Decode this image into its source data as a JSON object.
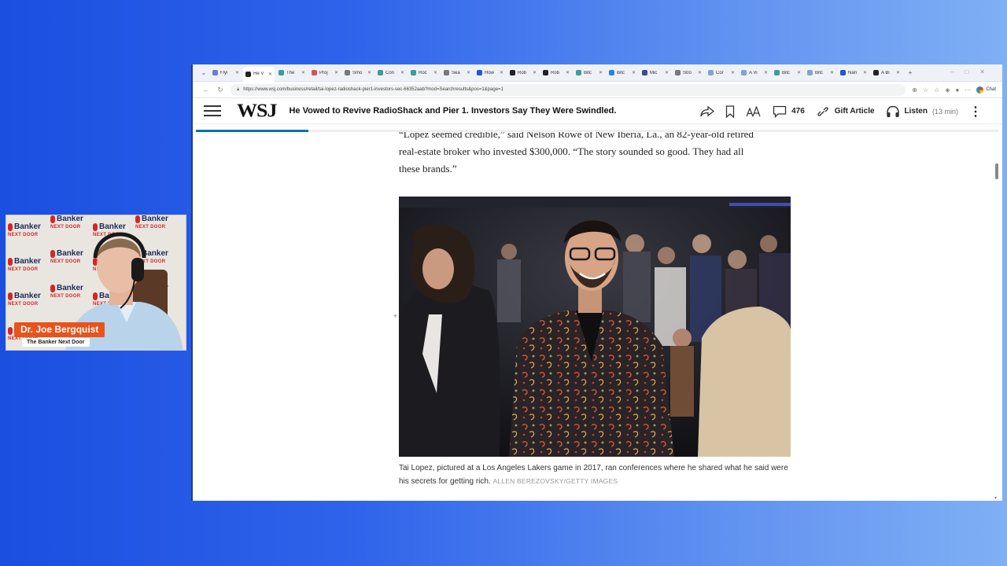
{
  "webcam": {
    "name": "Dr. Joe Bergquist",
    "title": "The Banker Next Door",
    "backdrop_logo": "Banker",
    "backdrop_sub": "NEXT DOOR",
    "accent": "#e8521b"
  },
  "browser": {
    "tabs": [
      {
        "label": "Flyi",
        "color": "#6b7bd6"
      },
      {
        "label": "He V",
        "color": "#222222",
        "active": true
      },
      {
        "label": "The",
        "color": "#3c9b9b"
      },
      {
        "label": "Proj",
        "color": "#d9534f"
      },
      {
        "label": "Smo",
        "color": "#777777"
      },
      {
        "label": "Con",
        "color": "#3c9b9b"
      },
      {
        "label": "Roc",
        "color": "#3c9b9b"
      },
      {
        "label": "Sea",
        "color": "#777777"
      },
      {
        "label": "How",
        "color": "#1f57d6"
      },
      {
        "label": "Rob",
        "color": "#222222"
      },
      {
        "label": "Rob",
        "color": "#222222"
      },
      {
        "label": "Bitc",
        "color": "#3c9b9b"
      },
      {
        "label": "Bitc",
        "color": "#1e88e5"
      },
      {
        "label": "Mic",
        "color": "#3c4b8a"
      },
      {
        "label": "Stro",
        "color": "#777777"
      },
      {
        "label": "Cor",
        "color": "#8aa0c8"
      },
      {
        "label": "A Vi",
        "color": "#8aa0c8"
      },
      {
        "label": "Bitc",
        "color": "#3c9b9b"
      },
      {
        "label": "Bitc",
        "color": "#8aa0c8"
      },
      {
        "label": "Nan",
        "color": "#1f57d6"
      },
      {
        "label": "A Bi",
        "color": "#222222"
      }
    ],
    "new_tab_label": "+",
    "url": "https://www.wsj.com/business/retail/tai-lopez-radioshack-pier1-investors-sec-66352aab?mod=Searchresults&pos=1&page=1",
    "chat_label": "Chat"
  },
  "wsj": {
    "logo": "WSJ",
    "headline": "He Vowed to Revive RadioShack and Pier 1. Investors Say They Were Swindled.",
    "comment_count": "476",
    "gift_label": "Gift Article",
    "listen_label": "Listen",
    "listen_duration": "(13 min)",
    "accent": "#0274b6",
    "reading_progress": 0.14
  },
  "article": {
    "paragraph_line1": "“Lopez seemed credible,” said Nelson Rowe of New Iberia, La., an 82-year-old retired",
    "paragraph_line2": "real-estate broker who invested $300,000. “The story sounded so good. They had all",
    "paragraph_line3": "these brands.”",
    "caption": "Tai Lopez, pictured at a Los Angeles Lakers game in 2017, ran conferences where he shared what he said were his secrets for getting rich.",
    "credit": "ALLEN BEREZOVSKY/GETTY IMAGES"
  }
}
